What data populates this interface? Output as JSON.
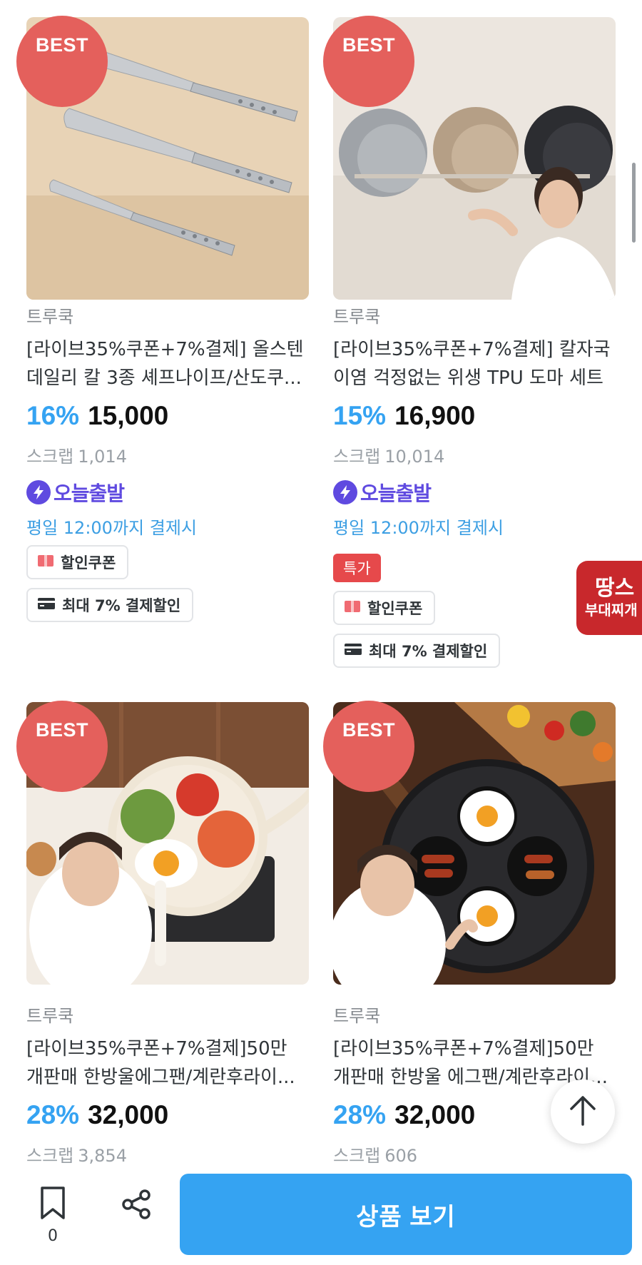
{
  "products": [
    {
      "badge": "BEST",
      "brand": "트루쿡",
      "title_line1": "[라이브35%쿠폰+7%결제] 올스텐",
      "title_line2": "데일리 칼 3종 셰프나이프/산도쿠...",
      "discount": "16%",
      "price": "15,000",
      "scrap_label": "스크랩",
      "scrap_count": "1,014",
      "today_label": "오늘출발",
      "deadline": "평일 12:00까지 결제시",
      "special": "",
      "coupon_label": "할인쿠폰",
      "payment_label": "최대 7% 결제할인",
      "image": "knife-set"
    },
    {
      "badge": "BEST",
      "brand": "트루쿡",
      "title_line1": "[라이브35%쿠폰+7%결제] 칼자국",
      "title_line2": "이염 걱정없는 위생 TPU 도마 세트",
      "discount": "15%",
      "price": "16,900",
      "scrap_label": "스크랩",
      "scrap_count": "10,014",
      "today_label": "오늘출발",
      "deadline": "평일 12:00까지 결제시",
      "special": "특가",
      "coupon_label": "할인쿠폰",
      "payment_label": "최대 7% 결제할인",
      "image": "cutting-boards"
    },
    {
      "badge": "BEST",
      "brand": "트루쿡",
      "title_line1": "[라이브35%쿠폰+7%결제]50만",
      "title_line2": "개판매 한방울에그팬/계란후라이...",
      "discount": "28%",
      "price": "32,000",
      "scrap_label": "스크랩",
      "scrap_count": "3,854",
      "image": "egg-pan-cream"
    },
    {
      "badge": "BEST",
      "brand": "트루쿡",
      "title_line1": "[라이브35%쿠폰+7%결제]50만",
      "title_line2": "개판매 한방울 에그팬/계란후라이...",
      "discount": "28%",
      "price": "32,000",
      "scrap_label": "스크랩",
      "scrap_count": "606",
      "image": "egg-pan-black"
    }
  ],
  "side_banner": {
    "line1": "땅스",
    "line2": "부대찌개"
  },
  "bottom_bar": {
    "bookmark_count": "0",
    "cta_label": "상품 보기"
  },
  "colors": {
    "accent_blue": "#35a3f2",
    "best_badge": "#e4605c",
    "today_purple": "#5f4ae0",
    "special_red": "#e6494b"
  },
  "icons": [
    "bookmark-icon",
    "share-icon",
    "arrow-up-icon",
    "lightning-icon",
    "coupon-icon",
    "card-icon"
  ]
}
